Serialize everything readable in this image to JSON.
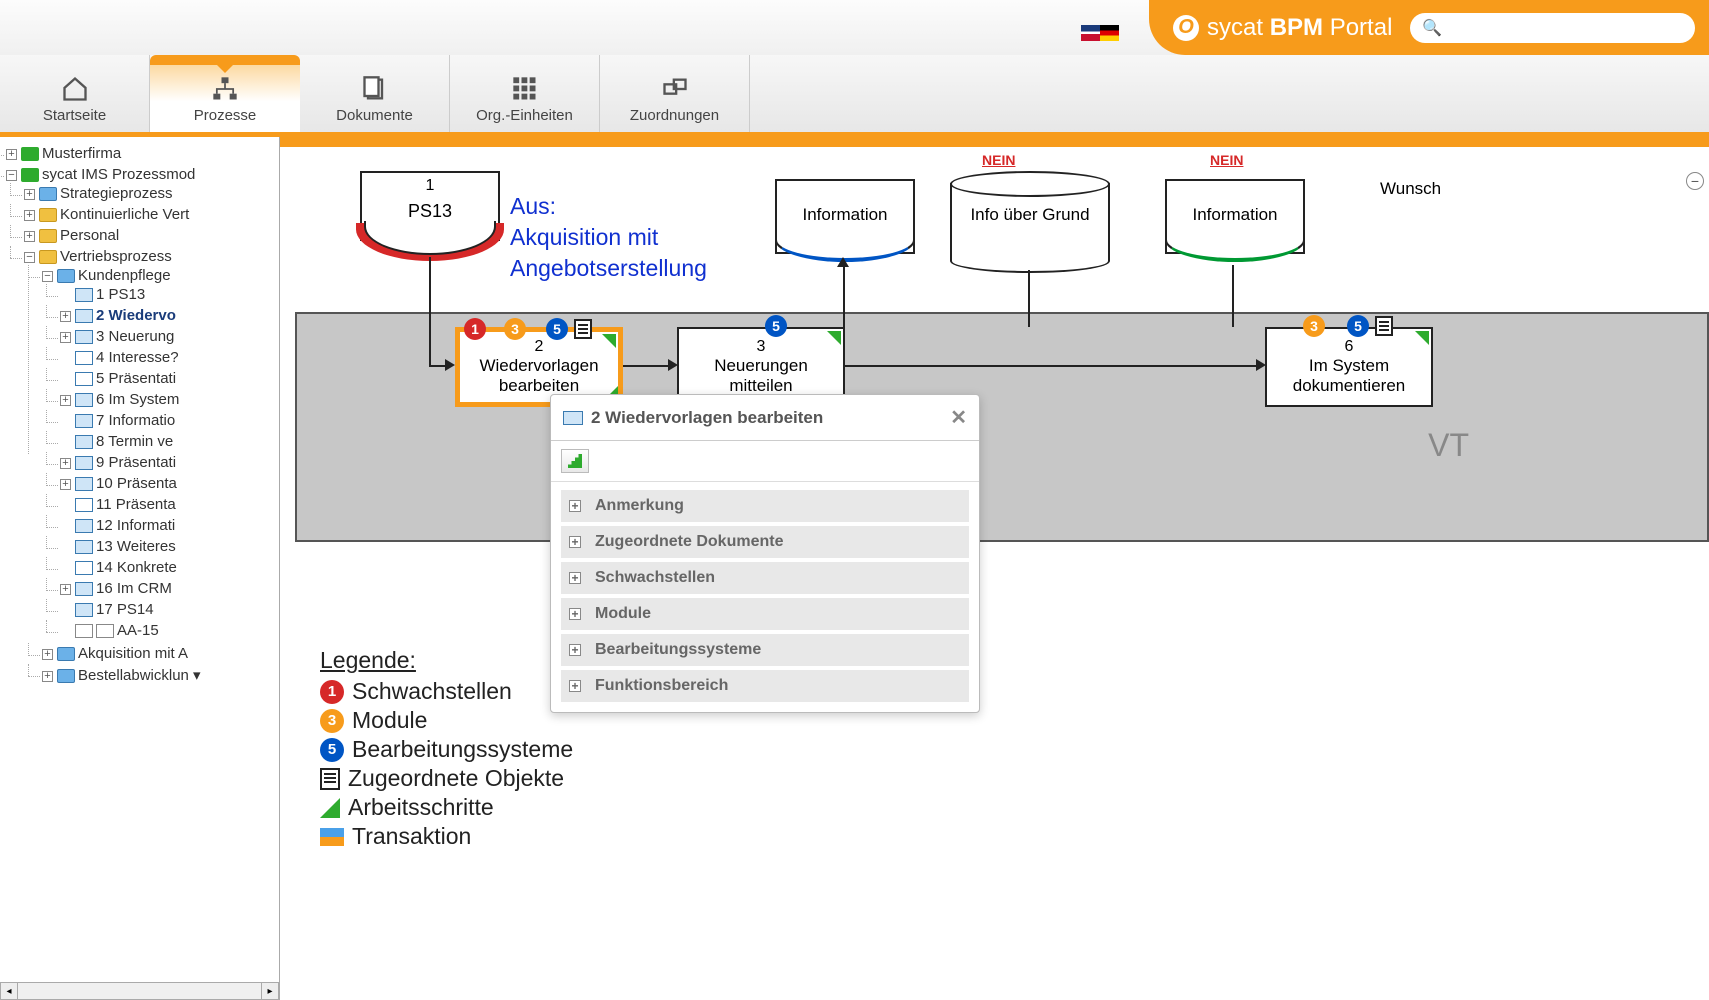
{
  "brand": {
    "name_prefix": "sycat",
    "name_bold": "BPM",
    "name_suffix": "Portal"
  },
  "search": {
    "placeholder": ""
  },
  "tabs": [
    {
      "label": "Startseite"
    },
    {
      "label": "Prozesse"
    },
    {
      "label": "Dokumente"
    },
    {
      "label": "Org.-Einheiten"
    },
    {
      "label": "Zuordnungen"
    }
  ],
  "tree": {
    "musterfirma": "Musterfirma",
    "ims": "sycat IMS Prozessmod",
    "strategie": "Strategieprozess",
    "kontinuierliche": "Kontinuierliche Vert",
    "personal": "Personal",
    "vertrieb": "Vertriebsprozess",
    "kundenpflege": "Kundenpflege",
    "n1": "1 PS13",
    "n2": "2 Wiedervo",
    "n3": "3 Neuerung",
    "n4": "4 Interesse?",
    "n5": "5 Präsentati",
    "n6": "6 Im System",
    "n7": "7 Informatio",
    "n8": "8 Termin ve",
    "n9": "9 Präsentati",
    "n10": "10 Präsenta",
    "n11": "11 Präsenta",
    "n12": "12 Informati",
    "n13": "13 Weiteres",
    "n14": "14 Konkrete",
    "n16": "16 Im CRM",
    "n17": "17 PS14",
    "aa15": "AA-15",
    "akquisition": "Akquisition mit A",
    "bestell": "Bestellabwicklun"
  },
  "diagram": {
    "ps13_num": "1",
    "ps13_txt": "PS13",
    "aus": "Aus:\nAkquisition mit\nAngebotserstellung",
    "info1": "Information",
    "info2": "Information",
    "info_grund": "Info über Grund",
    "wunsch": "Wunsch",
    "task2_num": "2",
    "task2_txt": "Wiedervorlagen\nbearbeiten",
    "task3_num": "3",
    "task3_txt": "Neuerungen\nmitteilen",
    "task6_num": "6",
    "task6_txt": "Im System\ndokumentieren",
    "vt": "VT",
    "nein": "NEIN"
  },
  "popup": {
    "title": "2 Wiedervorlagen bearbeiten",
    "rows": [
      "Anmerkung",
      "Zugeordnete Dokumente",
      "Schwachstellen",
      "Module",
      "Bearbeitungssysteme",
      "Funktionsbereich"
    ]
  },
  "legend": {
    "title": "Legende:",
    "r1": "Schwachstellen",
    "r2": "Module",
    "r3": "Bearbeitungssysteme",
    "r4": "Zugeordnete Objekte",
    "r5": "Arbeitsschritte",
    "r6": "Transaktion"
  }
}
